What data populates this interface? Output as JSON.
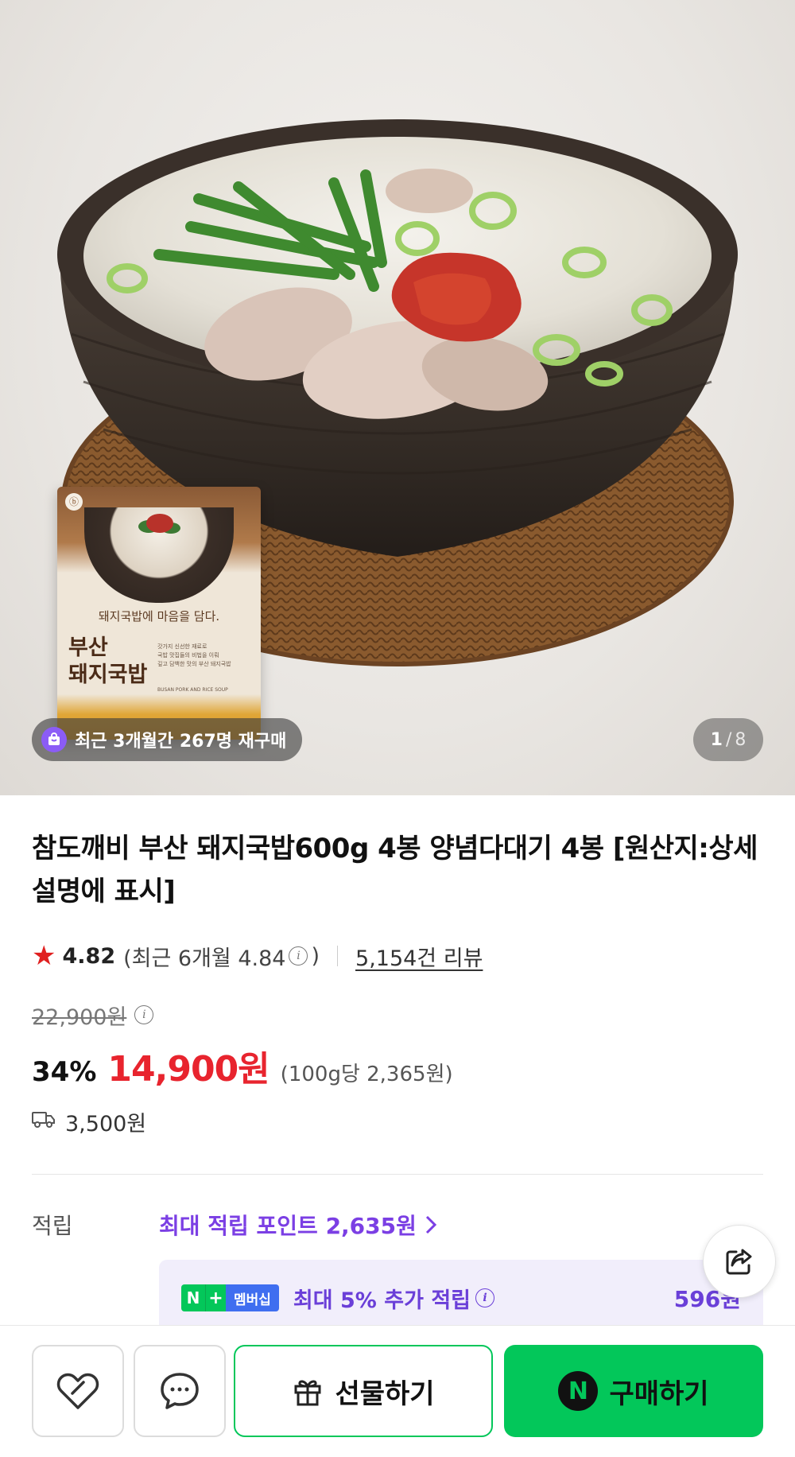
{
  "hero": {
    "badge_text": "최근 3개월간 267명 재구매",
    "page_current": "1",
    "page_separator": "/",
    "page_total": "8",
    "package": {
      "subtitle": "돼지국밥에 마음을 담다.",
      "title": "부산\n돼지국밥",
      "desc_lines": [
        "갓가지 신선한 재료로",
        "국밥 맛집들의 비법을 이뤄",
        "깊고 담백한 맛의 부산 돼지국밥"
      ],
      "eng_name": "BUSAN PORK AND RICE SOUP"
    }
  },
  "product": {
    "title": "참도깨비 부산 돼지국밥600g 4봉 양념다대기 4봉 [원산지:상세설명에 표시]",
    "rating": "4.82",
    "recent_rating_prefix": "(최근 6개월 4.84",
    "recent_rating_suffix": ")",
    "reviews": "5,154건 리뷰",
    "original_price": "22,900원",
    "discount": "34%",
    "sale_price": "14,900원",
    "unit_price": "(100g당 2,365원)",
    "shipping_fee": "3,500원"
  },
  "points": {
    "label": "적립",
    "max_points": "최대 적립 포인트 2,635원",
    "membership_n": "N",
    "membership_plus": "+",
    "membership_badge": "멤버십",
    "membership_text": "최대 5% 추가 적립",
    "membership_amount": "596원"
  },
  "actions": {
    "gift": "선물하기",
    "buy": "구매하기",
    "npay_letter": "N"
  },
  "colors": {
    "accent_green": "#03c75a",
    "price_red": "#e8242e",
    "points_purple": "#7b3fe4",
    "badge_purple": "#8b5cf6"
  }
}
